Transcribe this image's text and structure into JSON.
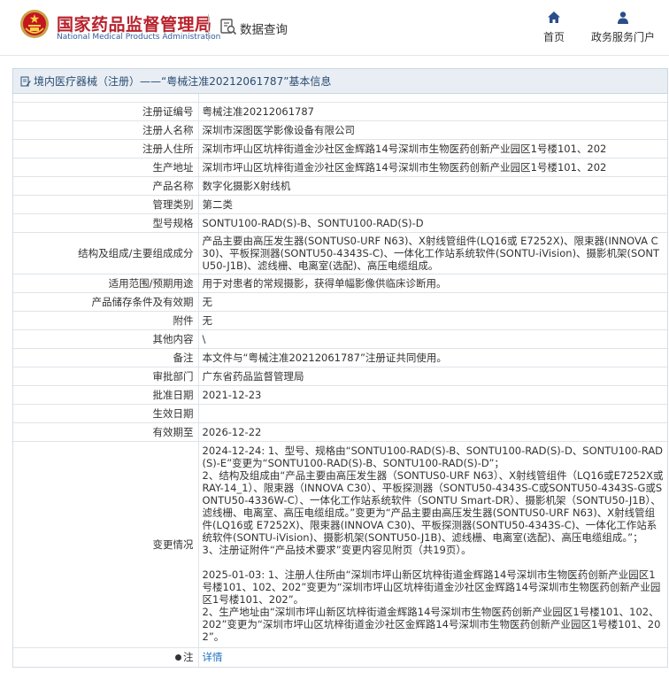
{
  "header": {
    "logo_cn": "国家药品监督管理局",
    "logo_en": "National Medical Products Administration",
    "query_label": "数据查询",
    "nav": [
      {
        "label": "首页",
        "icon": "home-icon"
      },
      {
        "label": "政务服务门户",
        "icon": "user-icon"
      }
    ]
  },
  "title_bar": {
    "text": "境内医疗器械（注册）——“粤械注准20212061787”基本信息"
  },
  "rows": [
    {
      "label": "注册证编号",
      "value": "粤械注准20212061787"
    },
    {
      "label": "注册人名称",
      "value": "深圳市深图医学影像设备有限公司"
    },
    {
      "label": "注册人住所",
      "value": "深圳市坪山区坑梓街道金沙社区金辉路14号深圳市生物医药创新产业园区1号楼101、202"
    },
    {
      "label": "生产地址",
      "value": "深圳市坪山区坑梓街道金沙社区金辉路14号深圳市生物医药创新产业园区1号楼101、202"
    },
    {
      "label": "产品名称",
      "value": "数字化摄影X射线机"
    },
    {
      "label": "管理类别",
      "value": "第二类"
    },
    {
      "label": "型号规格",
      "value": "SONTU100-RAD(S)-B、SONTU100-RAD(S)-D"
    },
    {
      "label": "结构及组成/主要组成成分",
      "value": "产品主要由高压发生器(SONTUS0-URF N63)、X射线管组件(LQ16或 E7252X)、限束器(INNOVA C30)、平板探测器(SONTU50-4343S-C)、一体化工作站系统软件(SONTU-iVision)、摄影机架(SONTU50-J1B)、滤线栅、电离室(选配)、高压电缆组成。"
    },
    {
      "label": "适用范围/预期用途",
      "value": "用于对患者的常规摄影，获得单幅影像供临床诊断用。"
    },
    {
      "label": "产品储存条件及有效期",
      "value": "无"
    },
    {
      "label": "附件",
      "value": "无"
    },
    {
      "label": "其他内容",
      "value": "\\"
    },
    {
      "label": "备注",
      "value": "本文件与“粤械注准20212061787”注册证共同使用。"
    },
    {
      "label": "审批部门",
      "value": "广东省药品监督管理局"
    },
    {
      "label": "批准日期",
      "value": "2021-12-23"
    },
    {
      "label": "生效日期",
      "value": ""
    },
    {
      "label": "有效期至",
      "value": "2026-12-22"
    }
  ],
  "change": {
    "label": "变更情况",
    "paragraphs": [
      "2024-12-24: 1、型号、规格由“SONTU100-RAD(S)-B、SONTU100-RAD(S)-D、SONTU100-RAD(S)-E”变更为“SONTU100-RAD(S)-B、SONTU100-RAD(S)-D”；\n2、结构及组成由“产品主要由高压发生器（SONTUS0-URF N63）、X射线管组件（LQ16或E7252X或RAY-14_1）、限束器（INNOVA C30）、平板探测器（SONTU50-4343S-C或SONTU50-4343S-G或SONTU50-4336W-C）、一体化工作站系统软件（SONTU Smart-DR）、摄影机架（SONTU50-J1B）、滤线栅、电离室、高压电缆组成。”变更为“产品主要由高压发生器(SONTUS0-URF N63)、X射线管组件(LQ16或 E7252X)、限束器(INNOVA C30)、平板探测器(SONTU50-4343S-C)、一体化工作站系统软件(SONTU-iVision)、摄影机架(SONTU50-J1B)、滤线栅、电离室(选配)、高压电缆组成。”；\n3、注册证附件“产品技术要求”变更内容见附页（共19页）。",
      "2025-01-03: 1、注册人住所由“深圳市坪山新区坑梓街道金辉路14号深圳市生物医药创新产业园区1号楼101、102、202”变更为“深圳市坪山区坑梓街道金沙社区金辉路14号深圳市生物医药创新产业园区1号楼101、202”。\n2、生产地址由“深圳市坪山新区坑梓街道金辉路14号深圳市生物医药创新产业园区1号楼101、102、202”变更为“深圳市坪山区坑梓街道金沙社区金辉路14号深圳市生物医药创新产业园区1号楼101、202”。"
    ]
  },
  "note": {
    "label": "注",
    "link": "详情"
  },
  "colors": {
    "brand_red": "#b8212c",
    "brand_blue": "#2d5e9a",
    "link": "#1a6fc2"
  }
}
